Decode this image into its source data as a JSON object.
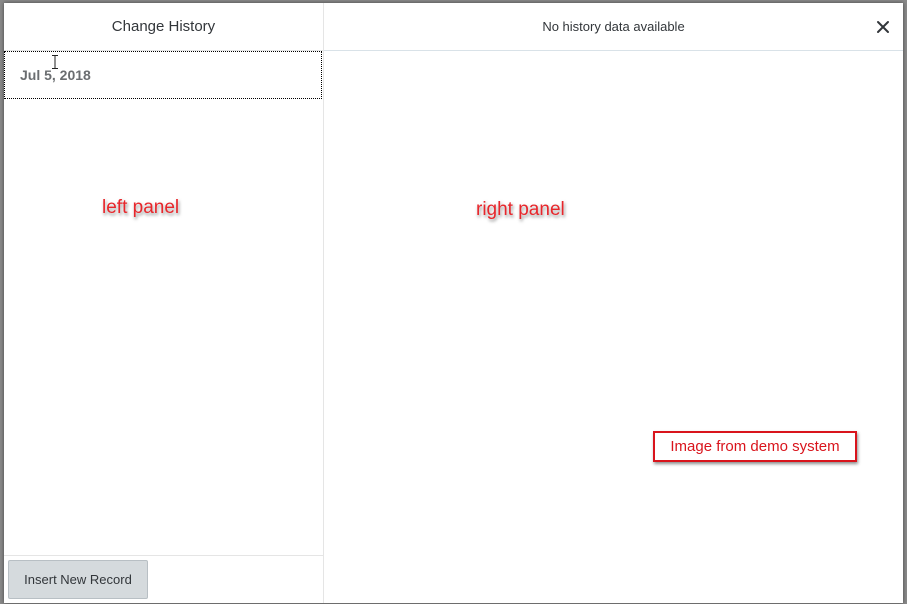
{
  "dialog": {
    "left_panel": {
      "title": "Change History",
      "items": [
        {
          "label": "Jul 5, 2018"
        }
      ],
      "footer": {
        "insert_label": "Insert New Record"
      }
    },
    "right_panel": {
      "title": "No history data available",
      "close_icon": "close-icon"
    }
  },
  "annotations": {
    "left_label": "left panel",
    "right_label": "right panel",
    "demo_note": "Image from demo system"
  },
  "colors": {
    "annotation_red": "#e8262b",
    "button_bg": "#d5dadd",
    "text": "#32363a",
    "date_text": "#6a6d70"
  }
}
